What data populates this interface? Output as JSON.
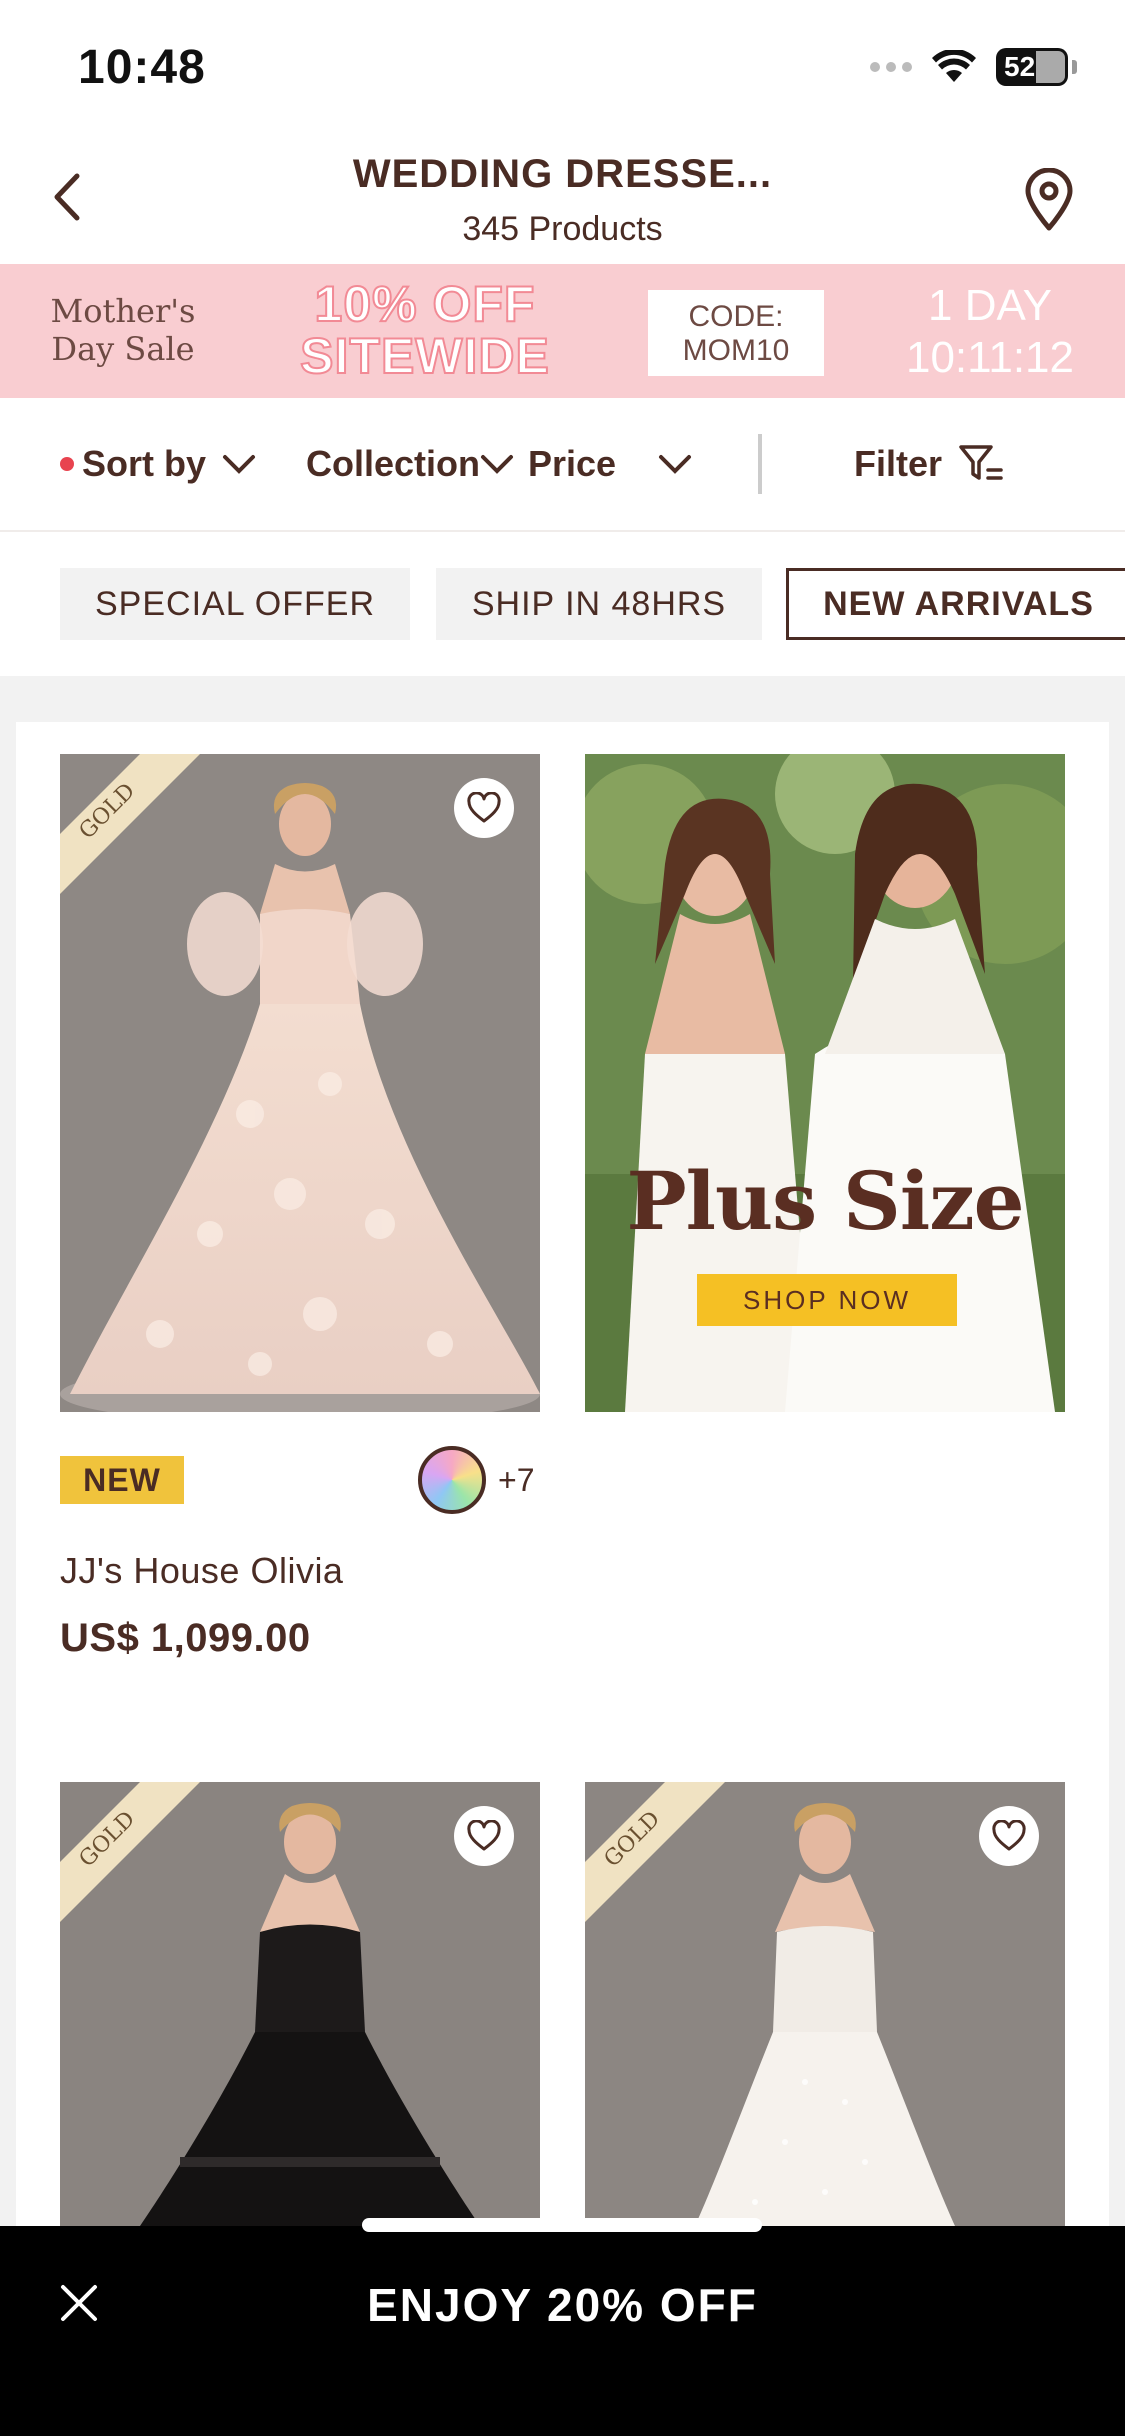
{
  "status_bar": {
    "time": "10:48",
    "battery": "52"
  },
  "header": {
    "title": "WEDDING DRESSE...",
    "subtitle": "345 Products"
  },
  "promo": {
    "event": "Mother's Day Sale",
    "offer_line1": "10% OFF",
    "offer_line2": "SITEWIDE",
    "code_line1": "CODE:",
    "code_line2": "MOM10",
    "timer_days": "1 DAY",
    "timer_clock": "10:11:12",
    "bg_color": "#f9cdd1"
  },
  "filters": {
    "sort_label": "Sort by",
    "collection_label": "Collection",
    "price_label": "Price",
    "filter_label": "Filter"
  },
  "tags": [
    {
      "label": "SPECIAL OFFER",
      "active": false
    },
    {
      "label": "SHIP IN 48HRS",
      "active": false
    },
    {
      "label": "NEW ARRIVALS",
      "active": true
    }
  ],
  "products": [
    {
      "ribbon": "GOLD",
      "badge": "NEW",
      "colors_more": "+7",
      "name": "JJ's House Olivia",
      "price": "US$ 1,099.00",
      "dress_color": "blush-ivory"
    },
    {
      "ribbon": "GOLD",
      "dress_color": "black"
    },
    {
      "ribbon": "GOLD",
      "dress_color": "ivory"
    }
  ],
  "banner_ad": {
    "title": "Plus Size",
    "button": "SHOP NOW"
  },
  "bottom_bar": {
    "text": "ENJOY 20% OFF"
  },
  "colors": {
    "brand_text": "#4a2c24",
    "accent_red": "#e8434f",
    "badge_yellow": "#f0c33c"
  }
}
